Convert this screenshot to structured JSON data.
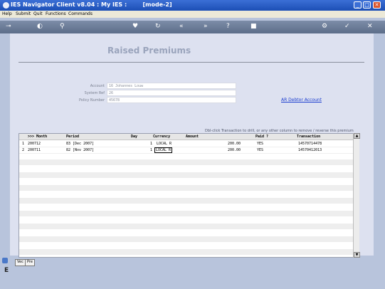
{
  "window": {
    "title": "IES Navigator Client v8.04 : My IES :        [mode-2]"
  },
  "menu": {
    "items": [
      "Help",
      "Submit",
      "Quit",
      "Functions",
      "Commands"
    ]
  },
  "page": {
    "title": "Raised Premiums"
  },
  "form": {
    "fields": [
      {
        "label": "Account",
        "value": "16 Johannes Louw"
      },
      {
        "label": "System Ref",
        "value": "26"
      },
      {
        "label": "Policy Number",
        "value": "45678"
      }
    ],
    "link": "AR Debtor Account"
  },
  "hint": "Dbl-click Transaction to drill, or any other   column to remove / reverse this premium",
  "grid": {
    "columns": [
      ">>> Month",
      "Period",
      "Day",
      "Currency",
      "Amount",
      "Paid ?",
      "Transaction"
    ],
    "rows": [
      {
        "num": "1",
        "month": "200712",
        "period": "83  [Dec 2007]",
        "day": "1",
        "currency": "LOCAL R",
        "amount": "200.00",
        "paid": "YES",
        "transaction": "14570714478"
      },
      {
        "num": "2",
        "month": "200711",
        "period": "82  [Nov 2007]",
        "day": "1",
        "currency": "LOCAL R",
        "amount": "200.00",
        "paid": "YES",
        "transaction": "14570412013"
      }
    ]
  },
  "tabs": [
    "Vec",
    "Pre"
  ],
  "icons": {
    "scroll_up": "▲",
    "scroll_down": "▼"
  }
}
